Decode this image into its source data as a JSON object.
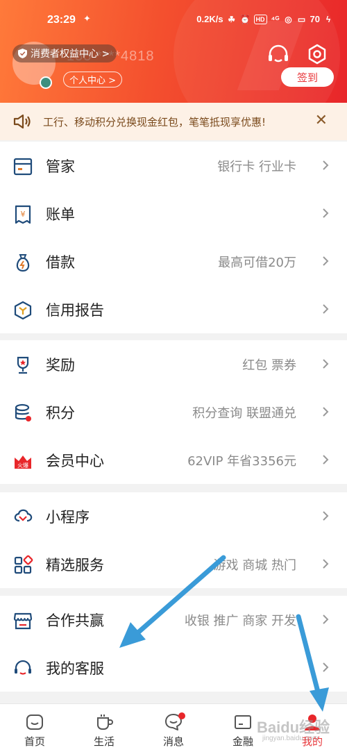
{
  "status_bar": {
    "time": "23:29",
    "speed": "0.2K/s",
    "battery": "70"
  },
  "header": {
    "rights_center": "消费者权益中心 >",
    "phone_masked": "155 ****4818",
    "personal_center": "个人中心 >",
    "checkin": "签到",
    "support_icon": "headset-icon",
    "settings_icon": "gear-icon",
    "gradient_start": "#ff7a3a",
    "gradient_end": "#e8262a"
  },
  "notice": {
    "text": "工行、移动积分兑换现金红包，笔笔抵现享优惠!",
    "close": "✕",
    "background": "#fdf1e6"
  },
  "menu": {
    "group1": [
      {
        "label": "管家",
        "hint": "银行卡 行业卡",
        "icon": "card-icon"
      },
      {
        "label": "账单",
        "hint": "",
        "icon": "bill-icon"
      },
      {
        "label": "借款",
        "hint": "最高可借20万",
        "icon": "money-bag-icon"
      },
      {
        "label": "信用报告",
        "hint": "",
        "icon": "credit-report-icon"
      }
    ],
    "group2": [
      {
        "label": "奖励",
        "hint": "红包 票券",
        "icon": "trophy-icon"
      },
      {
        "label": "积分",
        "hint": "积分查询 联盟通兑",
        "icon": "points-icon"
      },
      {
        "label": "会员中心",
        "hint": "62VIP 年省3356元",
        "icon": "vip-crown-icon",
        "badge": "火爆"
      }
    ],
    "group3": [
      {
        "label": "小程序",
        "hint": "",
        "icon": "mini-program-icon"
      },
      {
        "label": "精选服务",
        "hint": "游戏 商城 热门",
        "icon": "services-grid-icon"
      }
    ],
    "group4": [
      {
        "label": "合作共赢",
        "hint": "收银 推广 商家 开发",
        "icon": "store-icon"
      },
      {
        "label": "我的客服",
        "hint": "",
        "icon": "customer-service-icon"
      }
    ]
  },
  "tabbar": [
    {
      "label": "首页",
      "icon": "home-icon",
      "active": false
    },
    {
      "label": "生活",
      "icon": "cup-icon",
      "active": false
    },
    {
      "label": "消息",
      "icon": "message-icon",
      "active": false,
      "dot": true
    },
    {
      "label": "金融",
      "icon": "wallet-icon",
      "active": false
    },
    {
      "label": "我的",
      "icon": "profile-icon",
      "active": true
    }
  ],
  "watermark": {
    "text": "Baidu经验",
    "sub": "jingyan.baidu.com"
  },
  "colors": {
    "accent": "#e8363a",
    "arrow": "#3a9bd8"
  }
}
